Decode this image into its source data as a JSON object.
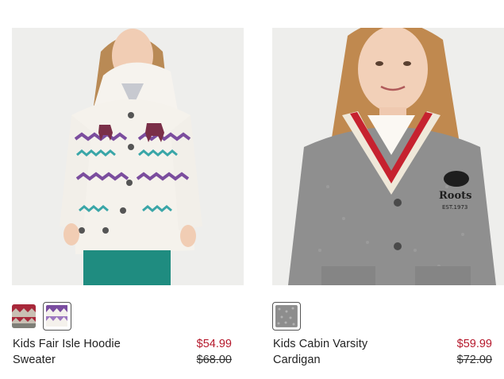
{
  "products": [
    {
      "name": "Kids Fair Isle Hoodie Sweater",
      "sale_price": "$54.99",
      "original_price": "$68.00",
      "image_alt": "Girl wearing a white fair isle hoodie sweater with purple and teal patterns",
      "swatches": [
        {
          "color_primary": "#a8283a",
          "color_secondary": "#c9c0b4",
          "selected": false
        },
        {
          "color_primary": "#7a4da0",
          "color_secondary": "#f4f1ec",
          "selected": true
        }
      ]
    },
    {
      "name": "Kids Cabin Varsity Cardigan",
      "sale_price": "$59.99",
      "original_price": "$72.00",
      "image_alt": "Girl wearing a grey cabin varsity cardigan with red and cream trim",
      "swatches": [
        {
          "color_primary": "#8d8d8d",
          "color_secondary": "#b2b2b2",
          "selected": true
        }
      ]
    }
  ],
  "colors": {
    "sale": "#b5182b",
    "text": "#222222",
    "photo_bg": "#eeeeec"
  }
}
